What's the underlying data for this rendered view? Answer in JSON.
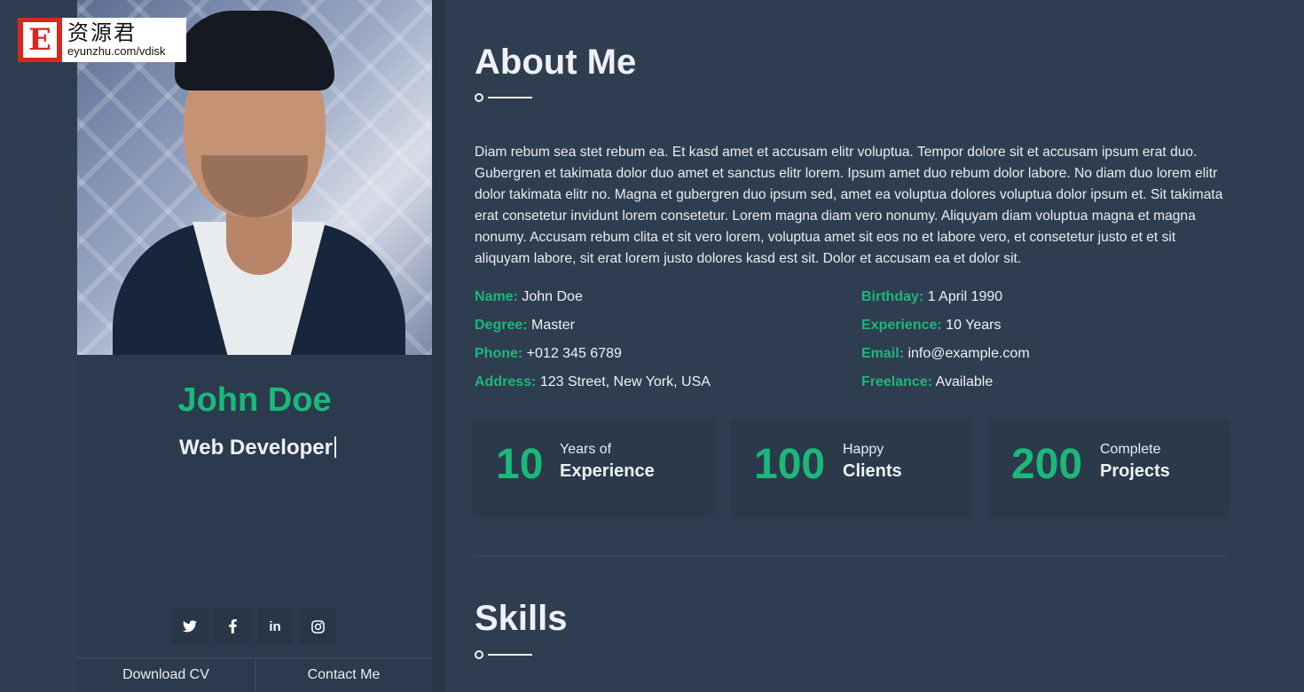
{
  "watermark": {
    "logo_letter": "E",
    "cn_text": "资源君",
    "url": "eyunzhu.com/vdisk"
  },
  "profile": {
    "name": "John Doe",
    "role": "Web Developer",
    "socials": [
      {
        "icon": "twitter-icon"
      },
      {
        "icon": "facebook-icon"
      },
      {
        "icon": "linkedin-icon",
        "label": "in"
      },
      {
        "icon": "instagram-icon"
      }
    ],
    "download_cv_label": "Download CV",
    "contact_me_label": "Contact Me"
  },
  "about": {
    "title": "About Me",
    "text": "Diam rebum sea stet rebum ea. Et kasd amet et accusam elitr voluptua. Tempor dolore sit et accusam ipsum erat duo. Gubergren et takimata dolor duo amet et sanctus elitr lorem. Ipsum amet duo rebum dolor labore. No diam duo lorem elitr dolor takimata elitr no. Magna et gubergren duo ipsum sed, amet ea voluptua dolores voluptua dolor ipsum et. Sit takimata erat consetetur invidunt lorem consetetur. Lorem magna diam vero nonumy. Aliquyam diam voluptua magna et magna nonumy. Accusam rebum clita et sit vero lorem, voluptua amet sit eos no et labore vero, et consetetur justo et et sit aliquyam labore, sit erat lorem justo dolores kasd est sit. Dolor et accusam ea et dolor sit.",
    "info": [
      {
        "label": "Name:",
        "value": "John Doe"
      },
      {
        "label": "Birthday:",
        "value": "1 April 1990"
      },
      {
        "label": "Degree:",
        "value": "Master"
      },
      {
        "label": "Experience:",
        "value": "10 Years"
      },
      {
        "label": "Phone:",
        "value": "+012 345 6789"
      },
      {
        "label": "Email:",
        "value": "info@example.com"
      },
      {
        "label": "Address:",
        "value": "123 Street, New York, USA"
      },
      {
        "label": "Freelance:",
        "value": "Available"
      }
    ],
    "stats": [
      {
        "number": "10",
        "small": "Years of",
        "big": "Experience"
      },
      {
        "number": "100",
        "small": "Happy",
        "big": "Clients"
      },
      {
        "number": "200",
        "small": "Complete",
        "big": "Projects"
      }
    ]
  },
  "skills": {
    "title": "Skills"
  },
  "colors": {
    "accent": "#1ab979",
    "background": "#2f3d50",
    "sidebar": "#2c3a4d",
    "text": "#e9edf2"
  }
}
